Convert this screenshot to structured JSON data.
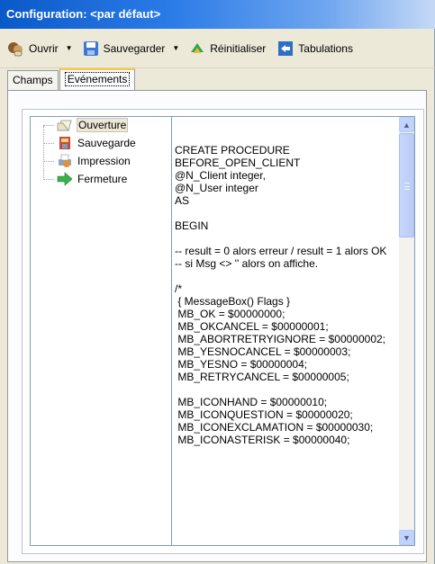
{
  "window": {
    "title": "Configuration: <par défaut>"
  },
  "toolbar": {
    "open_label": "Ouvrir",
    "save_label": "Sauvegarder",
    "reset_label": "Réinitialiser",
    "tabs_label": "Tabulations"
  },
  "tabs": [
    {
      "label": "Champs",
      "active": false
    },
    {
      "label": "Evénements",
      "active": true
    }
  ],
  "tree": {
    "items": [
      {
        "label": "Ouverture",
        "icon": "open-folder-icon",
        "selected": true
      },
      {
        "label": "Sauvegarde",
        "icon": "save-icon",
        "selected": false
      },
      {
        "label": "Impression",
        "icon": "print-icon",
        "selected": false
      },
      {
        "label": "Fermeture",
        "icon": "green-arrow-icon",
        "selected": false
      }
    ]
  },
  "editor": {
    "content": "CREATE PROCEDURE\nBEFORE_OPEN_CLIENT\n@N_Client integer,\n@N_User integer\nAS\n\nBEGIN\n\n-- result = 0 alors erreur / result = 1 alors OK\n-- si Msg <> '' alors on affiche.\n\n/*\n { MessageBox() Flags }\n MB_OK = $00000000;\n MB_OKCANCEL = $00000001;\n MB_ABORTRETRYIGNORE = $00000002;\n MB_YESNOCANCEL = $00000003;\n MB_YESNO = $00000004;\n MB_RETRYCANCEL = $00000005;\n\n MB_ICONHAND = $00000010;\n MB_ICONQUESTION = $00000020;\n MB_ICONEXCLAMATION = $00000030;\n MB_ICONASTERISK = $00000040;"
  },
  "colors": {
    "title_gradient_start": "#0a59c9",
    "window_bg": "#ece9d8",
    "active_tab_accent": "#ffc83c"
  }
}
